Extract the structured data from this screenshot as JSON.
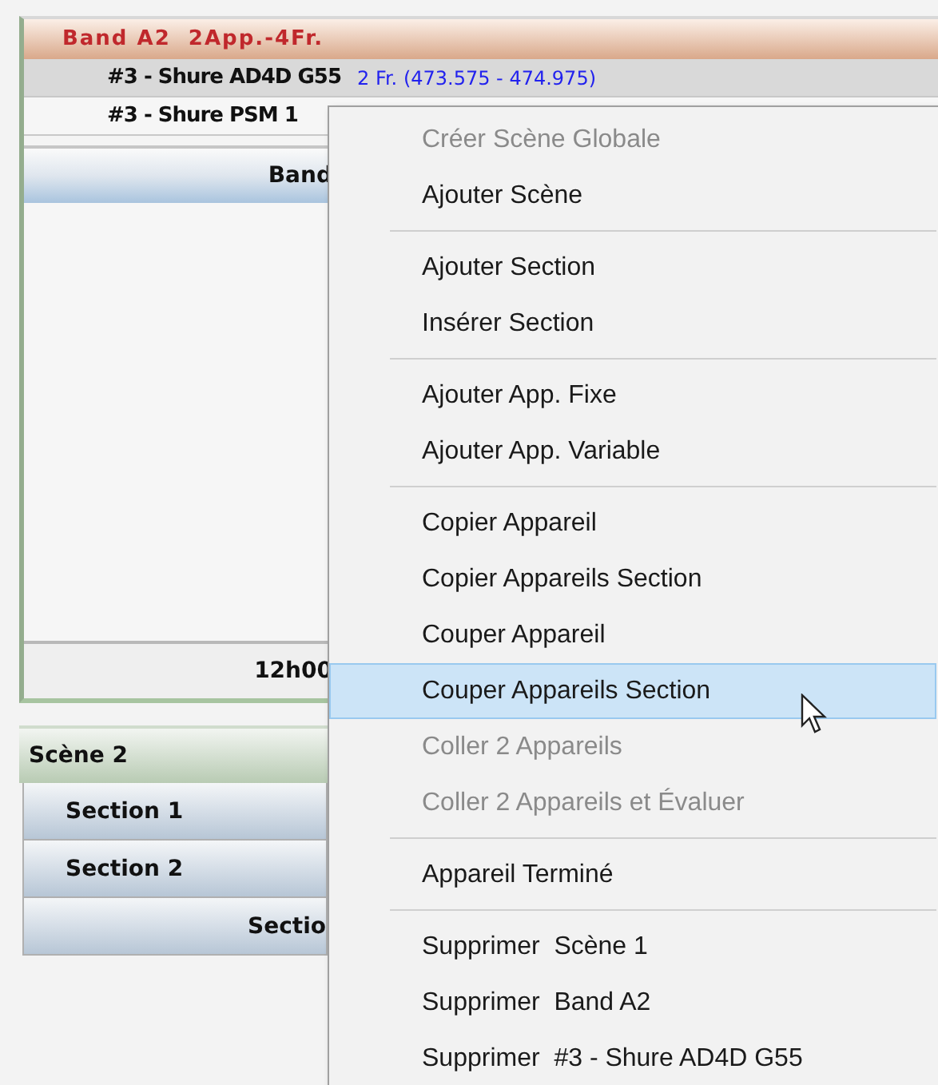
{
  "band": {
    "title": "Band A2  2App.-4Fr.",
    "rows": [
      {
        "name": "#3 - Shure AD4D G55",
        "detail": "2 Fr. (473.575 - 474.975)",
        "selected": true
      },
      {
        "name": "#3 - Shure PSM 1",
        "selected": false
      }
    ],
    "section_header": "Band",
    "time": "12h00"
  },
  "scene": {
    "title": "Scène 2",
    "sections": [
      {
        "label": "Section 1",
        "kind": "left"
      },
      {
        "label": "Section 2",
        "kind": "left"
      },
      {
        "label": "Sectio",
        "kind": "centered"
      }
    ]
  },
  "context_menu": [
    {
      "kind": "item",
      "label": "Créer Scène Globale",
      "disabled": true,
      "selected": false
    },
    {
      "kind": "item",
      "label": "Ajouter Scène",
      "disabled": false,
      "selected": false
    },
    {
      "kind": "separator"
    },
    {
      "kind": "item",
      "label": "Ajouter Section",
      "disabled": false,
      "selected": false
    },
    {
      "kind": "item",
      "label": "Insérer Section",
      "disabled": false,
      "selected": false
    },
    {
      "kind": "separator"
    },
    {
      "kind": "item",
      "label": "Ajouter App. Fixe",
      "disabled": false,
      "selected": false
    },
    {
      "kind": "item",
      "label": "Ajouter App. Variable",
      "disabled": false,
      "selected": false
    },
    {
      "kind": "separator"
    },
    {
      "kind": "item",
      "label": "Copier Appareil",
      "disabled": false,
      "selected": false
    },
    {
      "kind": "item",
      "label": "Copier Appareils Section",
      "disabled": false,
      "selected": false
    },
    {
      "kind": "item",
      "label": "Couper Appareil",
      "disabled": false,
      "selected": false
    },
    {
      "kind": "item",
      "label": "Couper Appareils Section",
      "disabled": false,
      "selected": true
    },
    {
      "kind": "item",
      "label": "Coller 2 Appareils",
      "disabled": true,
      "selected": false
    },
    {
      "kind": "item",
      "label": "Coller 2 Appareils et Évaluer",
      "disabled": true,
      "selected": false
    },
    {
      "kind": "separator"
    },
    {
      "kind": "item",
      "label": "Appareil Terminé",
      "disabled": false,
      "selected": false
    },
    {
      "kind": "separator"
    },
    {
      "kind": "item",
      "label": "Supprimer  Scène 1",
      "disabled": false,
      "selected": false
    },
    {
      "kind": "item",
      "label": "Supprimer  Band A2",
      "disabled": false,
      "selected": false
    },
    {
      "kind": "item",
      "label": "Supprimer  #3 - Shure AD4D G55",
      "disabled": false,
      "selected": false
    }
  ]
}
